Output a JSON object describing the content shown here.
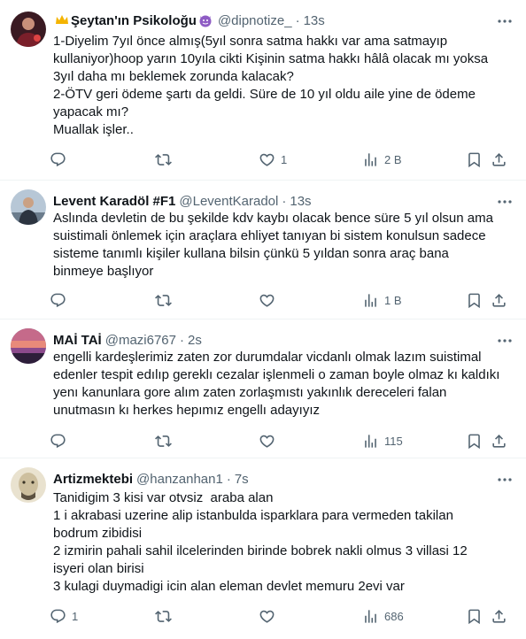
{
  "tweets": [
    {
      "display_name": "Şeytan'ın Psikoloğu",
      "handle": "@dipnotize_",
      "separator": "·",
      "time": "13s",
      "lines": [
        "1-Diyelim 7yıl önce almış(5yıl sonra satma hakkı var ama satmayıp",
        "kullaniyor)hoop yarın 10yıla cikti Kişinin satma hakkı hâlâ olacak mı yoksa",
        "3yıl daha mı beklemek zorunda kalacak?",
        "2-ÖTV geri ödeme şartı da geldi. Süre de 10 yıl oldu aile yine de ödeme",
        "yapacak mı?",
        "Muallak işler.."
      ],
      "replies": "",
      "retweets": "",
      "likes": "1",
      "views": "2 B"
    },
    {
      "display_name": "Levent Karadöl #F1",
      "handle": "@LeventKaradol",
      "separator": "·",
      "time": "13s",
      "lines": [
        "Aslında devletin de bu şekilde kdv kaybı olacak bence süre 5 yıl olsun ama",
        "suistimali önlemek için araçlara ehliyet tanıyan bi sistem konulsun sadece",
        "sisteme tanımlı kişiler kullana bilsin çünkü 5 yıldan sonra araç bana",
        "binmeye başlıyor"
      ],
      "replies": "",
      "retweets": "",
      "likes": "",
      "views": "1 B"
    },
    {
      "display_name": "MAİ TAİ",
      "handle": "@mazi6767",
      "separator": "·",
      "time": "2s",
      "lines": [
        "engelli kardeşlerimiz zaten zor durumdalar vicdanlı olmak lazım suistimal",
        "edenler tespit edılıp gereklı cezalar işlenmeli o zaman boyle olmaz kı kaldıkı",
        "yenı kanunlara gore alım zaten zorlaşmıstı yakınlık dereceleri falan",
        "unutmasın kı herkes hepımız engellı adayıyız"
      ],
      "replies": "",
      "retweets": "",
      "likes": "",
      "views": "115"
    },
    {
      "display_name": "Artizmektebi",
      "handle": "@hanzanhan1",
      "separator": "·",
      "time": "7s",
      "lines": [
        "Tanidigim 3 kisi var otvsiz  araba alan",
        "1 i akrabasi uzerine alip istanbulda isparklara para vermeden takilan",
        "bodrum zibidisi",
        "2 izmirin pahali sahil ilcelerinden birinde bobrek nakli olmus 3 villasi 12",
        "isyeri olan birisi",
        "3 kulagi duymadigi icin alan eleman devlet memuru 2evi var"
      ],
      "replies": "1",
      "retweets": "",
      "likes": "",
      "views": "686"
    }
  ]
}
